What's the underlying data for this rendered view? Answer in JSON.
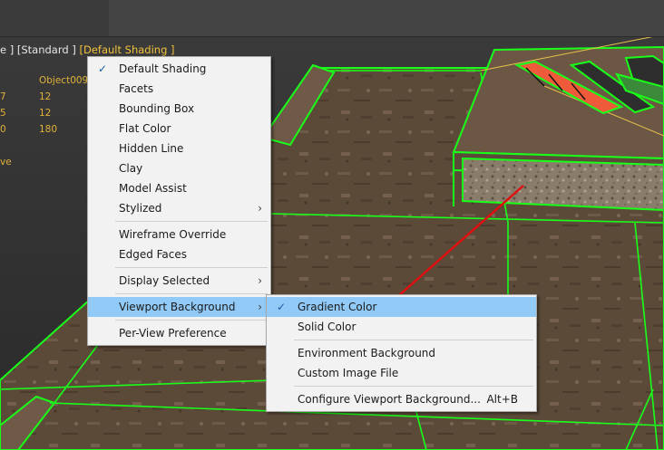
{
  "viewport": {
    "label_prefix": "e ]",
    "label_standard": "[Standard ]",
    "label_shading": "[Default Shading ]",
    "stats": [
      {
        "key": "",
        "value": "Object009"
      },
      {
        "key": "7",
        "value": "12"
      },
      {
        "key": "5",
        "value": "12"
      },
      {
        "key": "0",
        "value": "180"
      },
      {
        "key": "",
        "value": ""
      },
      {
        "key": "ve",
        "value": ""
      }
    ]
  },
  "menu": {
    "items": {
      "default_shading": "Default Shading",
      "facets": "Facets",
      "bounding_box": "Bounding Box",
      "flat_color": "Flat Color",
      "hidden_line": "Hidden Line",
      "clay": "Clay",
      "model_assist": "Model Assist",
      "stylized": "Stylized",
      "wireframe_override": "Wireframe Override",
      "edged_faces": "Edged Faces",
      "display_selected": "Display Selected",
      "viewport_background": "Viewport Background",
      "per_view_preference": "Per-View Preference"
    },
    "check_glyph": "✓",
    "arrow_glyph": "›"
  },
  "submenu": {
    "items": {
      "gradient_color": "Gradient Color",
      "solid_color": "Solid Color",
      "environment_background": "Environment Background",
      "custom_image_file": "Custom Image File",
      "configure": "Configure Viewport Background...",
      "configure_shortcut": "Alt+B"
    }
  },
  "colors": {
    "wire_green": "#19ff19",
    "annotation_red": "#e01010",
    "menu_highlight": "#91c9f7",
    "label_yellow": "#f0c23c"
  }
}
